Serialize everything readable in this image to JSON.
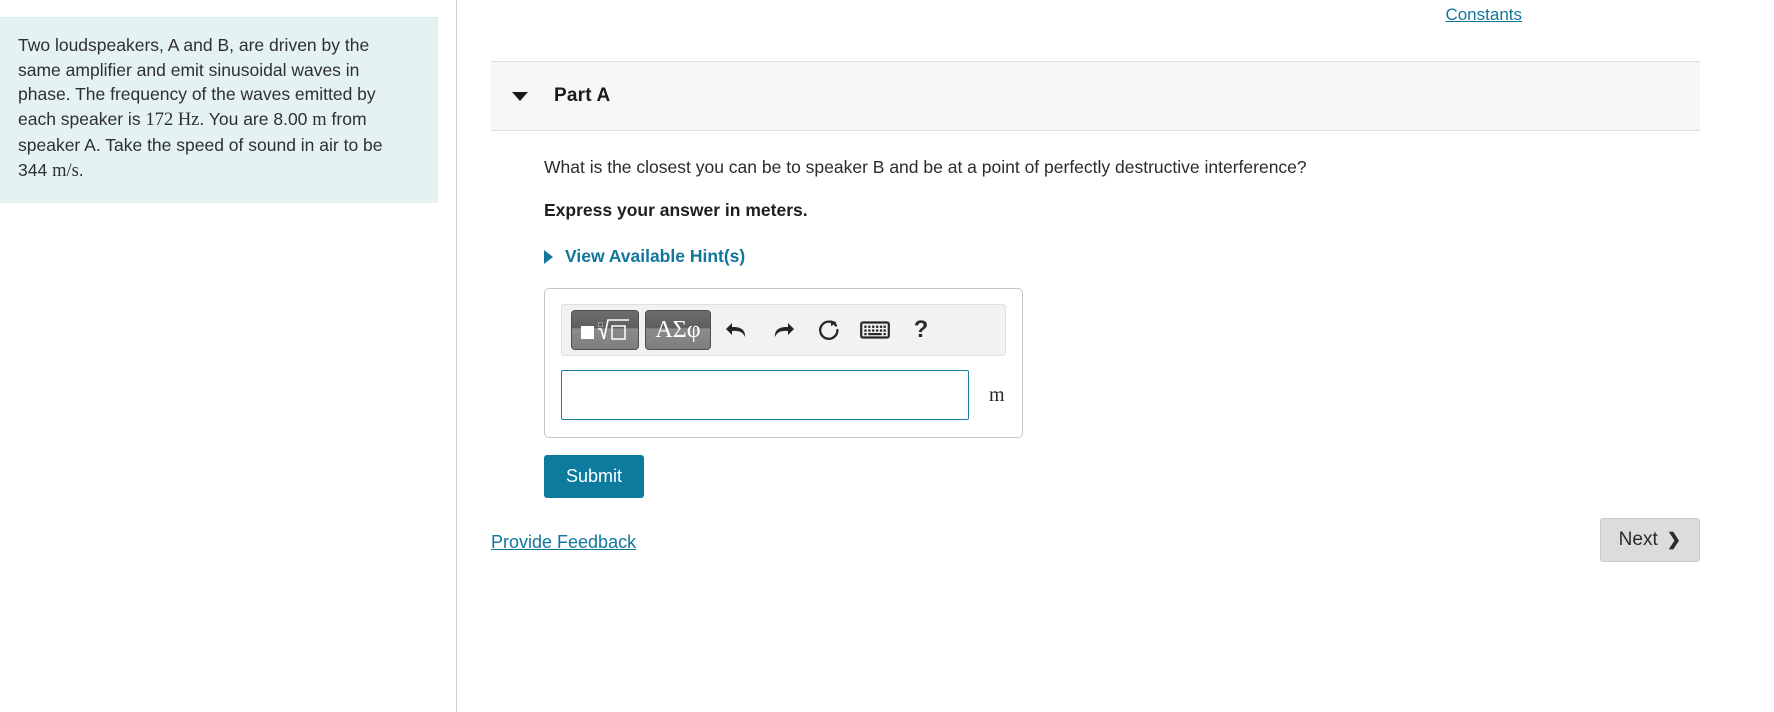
{
  "problem": {
    "text_part1": "Two loudspeakers, A and B, are driven by the same amplifier and emit sinusoidal waves in phase. The frequency of the waves emitted by each speaker is ",
    "frequency_value": "172 ",
    "frequency_unit": "Hz",
    "text_part2": ". You are 8.00 ",
    "distance_unit": "m",
    "text_part3": " from speaker A. Take the speed of sound in air to be 344 ",
    "speed_unit": "m/s",
    "text_part4": "."
  },
  "header": {
    "constants_link": "Constants"
  },
  "part": {
    "title": "Part A",
    "caret_icon": "caret-down-icon",
    "question": "What is the closest you can be to speaker B and be at a point of perfectly destructive interference?",
    "express_instruction": "Express your answer in meters.",
    "hints_label": "View Available Hint(s)",
    "hints_caret_icon": "caret-right-icon"
  },
  "answer": {
    "toolbar": {
      "template_button_label": "math-template",
      "greek_button_label": "ΑΣφ",
      "undo_label": "undo",
      "redo_label": "redo",
      "reset_label": "reset",
      "keyboard_label": "keyboard",
      "help_label": "?"
    },
    "input_value": "",
    "input_placeholder": "",
    "unit": "m",
    "submit_label": "Submit"
  },
  "footer": {
    "feedback_label": "Provide Feedback",
    "next_label": "Next",
    "next_chevron": "❯"
  },
  "colors": {
    "problem_bg": "#e4f2f3",
    "link": "#11759c",
    "submit_bg": "#0d7b9e",
    "input_border": "#1a7fa3",
    "part_header_bg": "#f7f7f7",
    "next_bg": "#dcdcdc"
  }
}
